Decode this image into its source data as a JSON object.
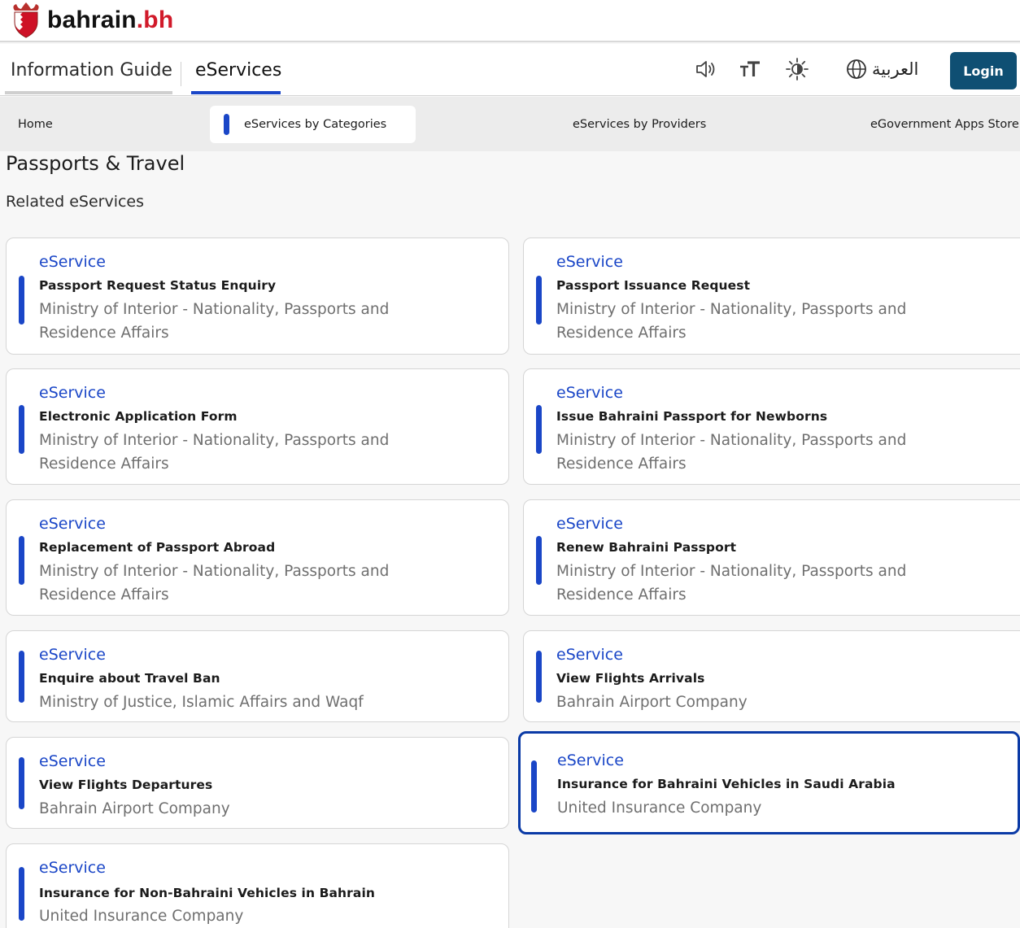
{
  "brand": {
    "name": "bahrain",
    "tld": ".bh"
  },
  "nav": {
    "tabs": [
      "Information Guide",
      "eServices"
    ],
    "active_tab": "eServices",
    "language_label": "العربية",
    "login_label": "Login"
  },
  "submenu": {
    "items": [
      "Home",
      "eServices by Categories",
      "eServices by Providers",
      "eGovernment Apps Store"
    ],
    "active": "eServices by Categories"
  },
  "page": {
    "title": "Passports & Travel",
    "subtitle": "Related eServices"
  },
  "cards": [
    {
      "kind": "eService",
      "name": "Passport Request Status Enquiry",
      "provider": "Ministry of Interior - Nationality, Passports and Residence Affairs"
    },
    {
      "kind": "eService",
      "name": "Passport Issuance Request",
      "provider": "Ministry of Interior - Nationality, Passports and Residence Affairs"
    },
    {
      "kind": "eService",
      "name": "Electronic Application Form",
      "provider": "Ministry of Interior - Nationality, Passports and Residence Affairs"
    },
    {
      "kind": "eService",
      "name": "Issue Bahraini Passport for Newborns",
      "provider": "Ministry of Interior - Nationality, Passports and Residence Affairs"
    },
    {
      "kind": "eService",
      "name": "Replacement of Passport Abroad",
      "provider": "Ministry of Interior - Nationality, Passports and Residence Affairs"
    },
    {
      "kind": "eService",
      "name": "Renew Bahraini Passport",
      "provider": "Ministry of Interior - Nationality, Passports and Residence Affairs"
    },
    {
      "kind": "eService",
      "name": "Enquire about Travel Ban",
      "provider": "Ministry of Justice, Islamic Affairs and Waqf"
    },
    {
      "kind": "eService",
      "name": "View Flights Arrivals",
      "provider": "Bahrain Airport Company"
    },
    {
      "kind": "eService",
      "name": "View Flights Departures",
      "provider": "Bahrain Airport Company"
    },
    {
      "kind": "eService",
      "name": "Insurance for Bahraini Vehicles in Saudi Arabia",
      "provider": "United Insurance Company"
    },
    {
      "kind": "eService",
      "name": "Insurance for Non-Bahraini Vehicles in Bahrain",
      "provider": "United Insurance Company"
    }
  ],
  "colors": {
    "accent": "#1a46c7",
    "login_bg": "#0f4f73",
    "brand_red": "#d11a2a",
    "selected_border": "#0a3aa6"
  }
}
